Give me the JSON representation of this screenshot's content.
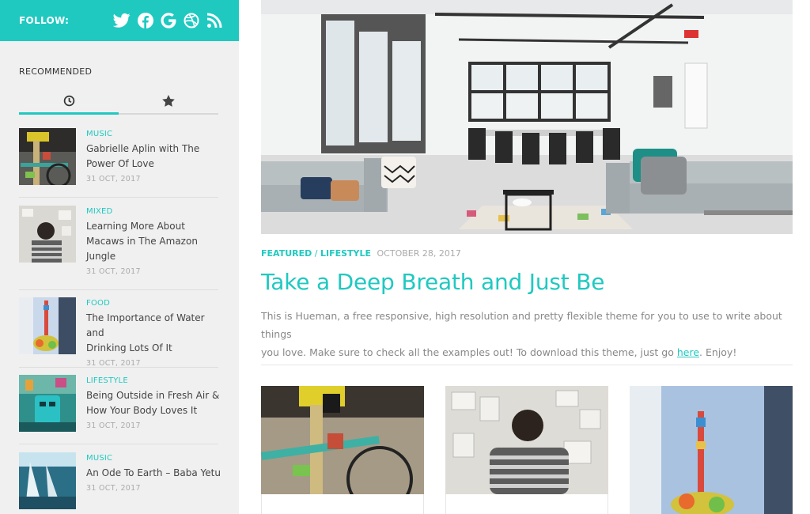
{
  "sidebar": {
    "follow_label": "FOLLOW:",
    "social": [
      "twitter-icon",
      "facebook-icon",
      "google-icon",
      "dribbble-icon",
      "rss-icon"
    ],
    "recommended_title": "RECOMMENDED",
    "tabs": [
      {
        "name": "recent-tab",
        "icon": "clock-icon",
        "active": true
      },
      {
        "name": "popular-tab",
        "icon": "star-icon",
        "active": false
      }
    ],
    "items": [
      {
        "category": "MUSIC",
        "title_lines": [
          "Gabrielle Aplin with The",
          "Power Of Love"
        ],
        "date": "31 OCT, 2017"
      },
      {
        "category": "MIXED",
        "title_lines": [
          "Learning More About",
          "Macaws in The Amazon",
          "Jungle"
        ],
        "date": "31 OCT, 2017"
      },
      {
        "category": "FOOD",
        "title_lines": [
          "The Importance of Water and",
          "Drinking Lots Of It"
        ],
        "date": "31 OCT, 2017"
      },
      {
        "category": "LIFESTYLE",
        "title_lines": [
          "Being Outside in Fresh Air &",
          "How Your Body Loves It"
        ],
        "date": "31 OCT, 2017"
      },
      {
        "category": "MUSIC",
        "title_lines": [
          "An Ode To Earth – Baba Yetu"
        ],
        "date": "31 OCT, 2017"
      }
    ]
  },
  "featured": {
    "categories": [
      "FEATURED",
      "LIFESTYLE"
    ],
    "separator": "/",
    "date": "OCTOBER 28, 2017",
    "title": "Take a Deep Breath and Just Be",
    "excerpt_line1": "This is Hueman, a free responsive, high resolution and pretty flexible theme for you to use to write about things",
    "excerpt_line2_pre": "you love. Make sure to check all the examples out! To download this theme, just go ",
    "excerpt_link": "here",
    "excerpt_line2_post": ". Enjoy!"
  },
  "colors": {
    "accent": "#1fc9c0",
    "sidebar_bg": "#f0f0f0",
    "text": "#444444",
    "muted": "#aaaaaa"
  }
}
